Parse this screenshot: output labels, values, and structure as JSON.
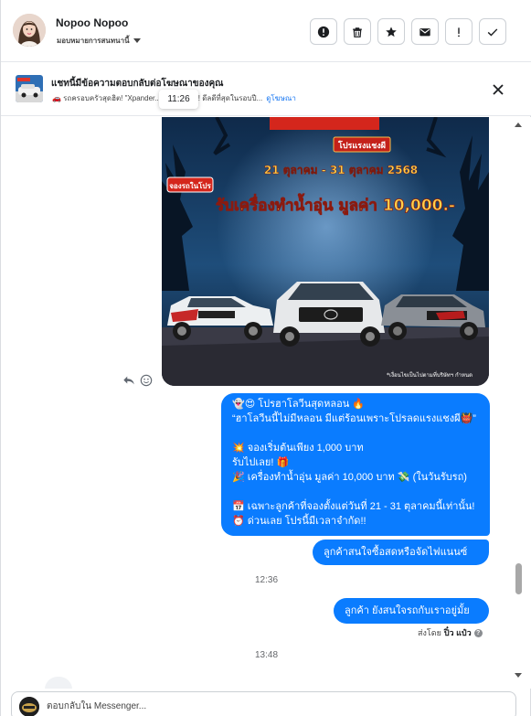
{
  "header": {
    "contact_name": "Nopoo Nopoo",
    "assign_label": "มอบหมายการสนทนานี้",
    "actions": [
      {
        "icon": "alert-circle-icon",
        "name": "mark-spam-button"
      },
      {
        "icon": "trash-icon",
        "name": "delete-button"
      },
      {
        "icon": "star-icon",
        "name": "star-button"
      },
      {
        "icon": "envelope-icon",
        "name": "mark-unread-button"
      },
      {
        "icon": "exclamation-icon",
        "name": "follow-up-button"
      },
      {
        "icon": "check-icon",
        "name": "done-button"
      }
    ]
  },
  "ad": {
    "title": "แชทนี้มีข้อความตอบกลับต่อโฆษณาของคุณ",
    "subtitle": "🚗 รถครอบครัวสุดฮิต! \"Xpander... ...ราคาแรง! ดีลดีที่สุดในรอบปี...",
    "link": "ดูโฆษณา",
    "tooltip_time": "11:26"
  },
  "promo_image": {
    "dates": "21 ตุลาคม - 31 ตุลาคม 2568",
    "headline": "รับเครื่องทำน้ำอุ่น มูลค่า 10,000.-",
    "tag": "จองรถในโปร",
    "banner": "โปรแรงแชงผี",
    "footnote": "*เงื่อนไขเป็นไปตามที่บริษัทฯ กำหนด"
  },
  "messages": {
    "main_lines": [
      "👻😍 โปรฮาโลวีนสุดหลอน 🔥",
      "“ฮาโลวีนนี้ไม่มีหลอน มีแต่ร้อนเพราะโปรลดแรงแชงผี👹”",
      "",
      "💥 จองเริ่มต้นเพียง 1,000 บาท",
      "รับไปเลย! 🎁",
      "🎉 เครื่องทำน้ำอุ่น มูลค่า 10,000 บาท 💸 (ในวันรับรถ)",
      "",
      "📅 เฉพาะลูกค้าที่จองตั้งแต่วันที่ 21 - 31 ตุลาคมนี้เท่านั้น!",
      "⏰ ด่วนเลย โปรนี้มีเวลาจำกัด!!"
    ],
    "msg2": "ลูกค้าสนใจซื้อสดหรือจัดไฟแนนซ์คะ",
    "time1": "12:36",
    "msg3": "ลูกค้า ยังสนใจรถกับเราอยู่มั้ยคะ",
    "sent_by_label": "ส่งโดย",
    "sent_by_name": "ปิ๋ว แป๋ว",
    "time2": "13:48"
  },
  "composer": {
    "placeholder": "ตอบกลับใน Messenger..."
  },
  "colors": {
    "bubble": "#0a7cff",
    "link": "#1877f2"
  }
}
